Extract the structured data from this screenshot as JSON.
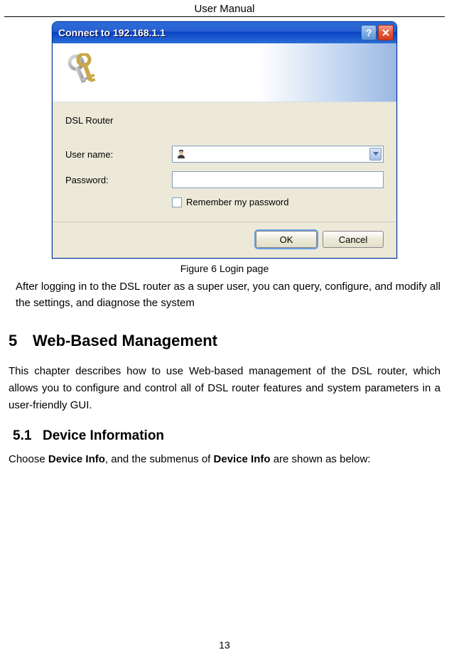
{
  "header": {
    "title": "User Manual"
  },
  "dialog": {
    "title": "Connect to 192.168.1.1",
    "server": "DSL Router",
    "username_label": "User name:",
    "password_label": "Password:",
    "username_value": "",
    "remember_label": "Remember my password",
    "ok_label": "OK",
    "cancel_label": "Cancel"
  },
  "figure_caption": "Figure 6 Login page",
  "para_after_login": "After logging in to the DSL router as a super user, you can query, configure, and modify all the settings, and diagnose the system",
  "section5": {
    "num": "5",
    "title": "Web-Based Management",
    "para": "This chapter describes how to use Web-based management of the DSL router, which allows you to configure and control all of DSL router features and system parameters in a user-friendly GUI."
  },
  "section51": {
    "num": "5.1",
    "title": "Device Information",
    "para_pre": "Choose ",
    "para_bold1": "Device Info",
    "para_mid": ", and the submenus of ",
    "para_bold2": "Device Info",
    "para_post": " are shown as below:"
  },
  "page_number": "13"
}
